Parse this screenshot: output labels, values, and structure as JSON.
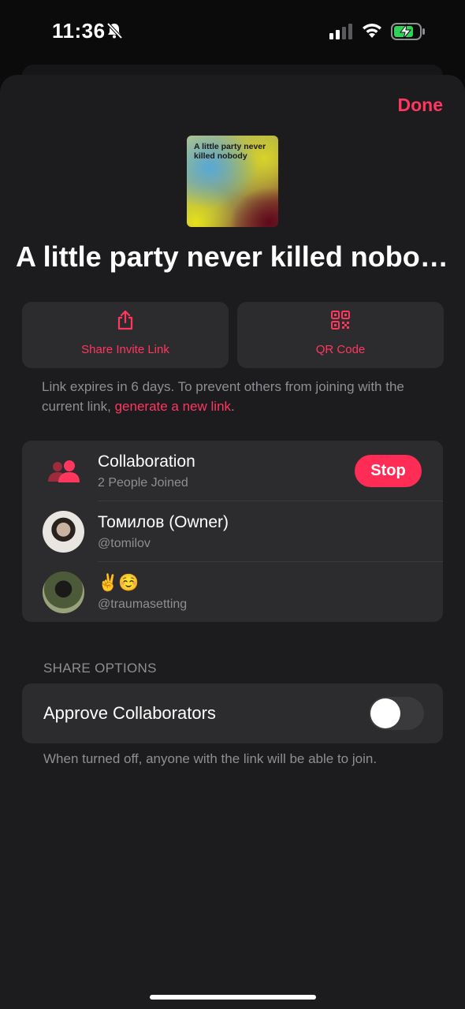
{
  "status_bar": {
    "time": "11:36",
    "bell_icon": "bell-slash-icon",
    "signal_icon": "signal-icon",
    "wifi_icon": "wifi-icon",
    "battery_icon": "battery-charging-icon"
  },
  "sheet": {
    "done_label": "Done",
    "artwork_text": "A little party never killed nobody",
    "title": "A little party never killed nobody"
  },
  "actions": {
    "share_label": "Share Invite Link",
    "share_icon": "share-icon",
    "qr_label": "QR Code",
    "qr_icon": "qr-code-icon"
  },
  "expiry": {
    "text": "Link expires in 6 days. To prevent others from joining with the current link, ",
    "link_text": "generate a new link",
    "suffix": "."
  },
  "collaboration": {
    "title": "Collaboration",
    "subtitle": "2 People Joined",
    "stop_label": "Stop",
    "icon": "people-icon",
    "members": [
      {
        "name": "Томилов (Owner)",
        "handle": "@tomilov"
      },
      {
        "name": "✌️☺️",
        "handle": "@traumasetting"
      }
    ]
  },
  "share_options": {
    "header": "SHARE OPTIONS",
    "approve_label": "Approve Collaborators",
    "approve_on": false,
    "footnote": "When turned off, anyone with the link will be able to join."
  },
  "colors": {
    "accent": "#ff375f",
    "background": "#1c1c1e",
    "card": "#2c2c2e",
    "secondary_text": "#8e8e93"
  }
}
